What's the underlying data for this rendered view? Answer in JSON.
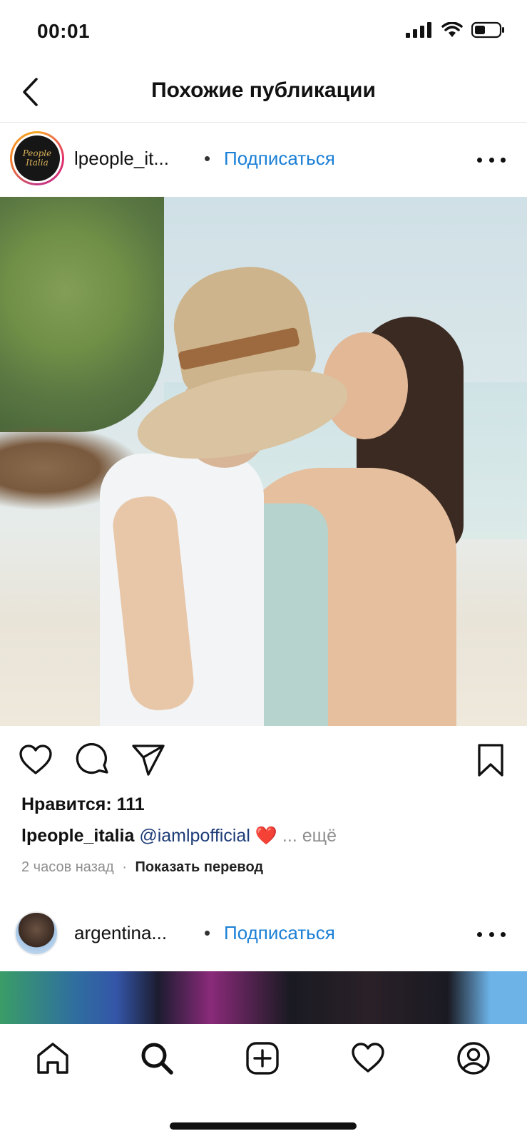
{
  "status_bar": {
    "time": "00:01"
  },
  "header": {
    "title": "Похожие публикации"
  },
  "post1": {
    "username": "lpeople_it...",
    "follow_label": "Подписаться",
    "separator": "•",
    "avatar_logo_line1": "People",
    "avatar_logo_line2": "Italia",
    "likes": "Нравится: 111",
    "caption_user": "lpeople_italia",
    "caption_mention": "@iamlpofficial",
    "caption_emoji": "❤️",
    "caption_more": "... ещё",
    "time_ago": "2 часов назад",
    "meta_separator": "·",
    "translate_label": "Показать перевод"
  },
  "post2": {
    "username": "argentina...",
    "follow_label": "Подписаться",
    "separator": "•"
  },
  "icons": {
    "back": "chevron-left-icon",
    "more": "more-horizontal-icon",
    "like": "heart-icon",
    "comment": "comment-icon",
    "share": "send-icon",
    "save": "bookmark-icon",
    "tab_home": "home-icon",
    "tab_search": "search-icon",
    "tab_create": "plus-square-icon",
    "tab_activity": "heart-icon",
    "tab_profile": "profile-icon"
  },
  "colors": {
    "follow_link": "#1a7fd6",
    "mention": "#1c3b77",
    "muted": "#8e8e8e"
  }
}
